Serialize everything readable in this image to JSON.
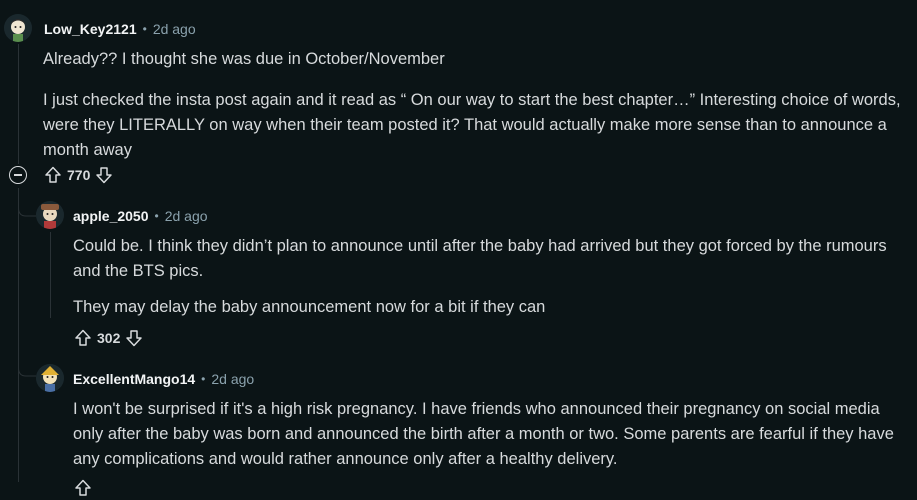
{
  "comments": [
    {
      "author": "Low_Key2121",
      "separator": "•",
      "time": "2d ago",
      "paragraphs": [
        "Already?? I thought she was due in October/November",
        "I just checked the insta post again and it read as “ On our way to start the best chapter…” Interesting choice of words, were they LITERALLY on way when their team posted it? That would actually make more sense than to announce a month away"
      ],
      "votes": "770"
    },
    {
      "author": "apple_2050",
      "separator": "•",
      "time": "2d ago",
      "paragraphs": [
        "Could be. I think they didn’t plan to announce until after the baby had arrived but they got forced by the rumours and the BTS pics.",
        "They may delay the baby announcement now for a bit if they can"
      ],
      "votes": "302"
    },
    {
      "author": "ExcellentMango14",
      "separator": "•",
      "time": "2d ago",
      "paragraphs": [
        "I won't be surprised if it's a high risk pregnancy. I have friends who announced their pregnancy on social media only after the baby was born and announced the birth after a month or two. Some parents are fearful if they have any complications and would rather announce only after a healthy delivery."
      ]
    }
  ],
  "icons": {
    "upvote": "upvote-icon",
    "downvote": "downvote-icon",
    "collapse": "collapse-icon"
  },
  "colors": {
    "background": "#0b1416",
    "text": "#d7dadc",
    "meta": "#8ba2ad"
  }
}
